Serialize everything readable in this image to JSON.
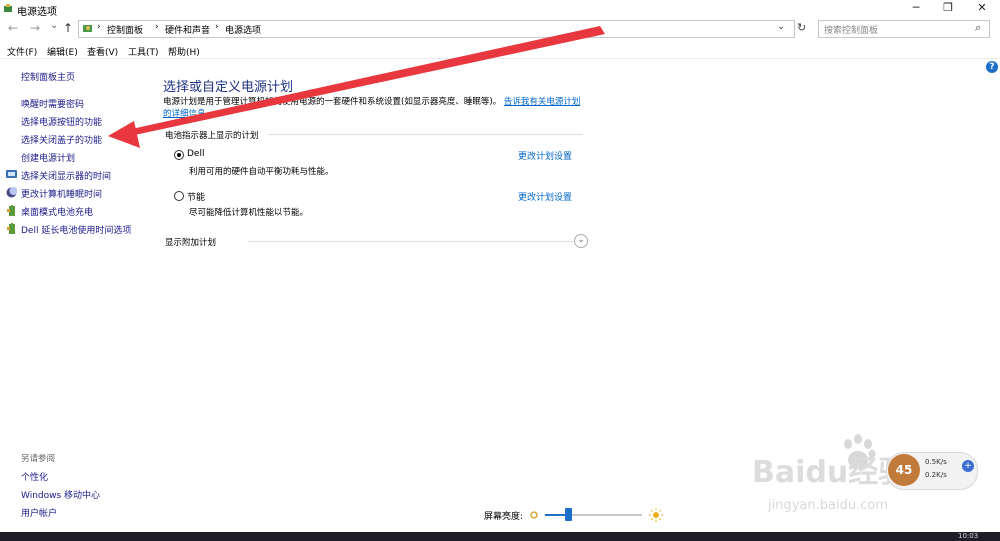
{
  "window": {
    "title": "电源选项",
    "minimize_glyph": "─",
    "maximize_glyph": "❐",
    "close_glyph": "✕"
  },
  "navigation": {
    "back_glyph": "←",
    "forward_glyph": "→",
    "dropdown_glyph": "⌄",
    "up_glyph": "↑",
    "breadcrumb": [
      "控制面板",
      "硬件和声音",
      "电源选项"
    ],
    "breadcrumb_sep": "›",
    "refresh_glyph": "↻",
    "search_placeholder": "搜索控制面板",
    "search_glyph": "⌕"
  },
  "menu": [
    "文件(F)",
    "编辑(E)",
    "查看(V)",
    "工具(T)",
    "帮助(H)"
  ],
  "sidebar": {
    "home": "控制面板主页",
    "items": [
      {
        "label": "唤醒时需要密码",
        "icon": "none"
      },
      {
        "label": "选择电源按钮的功能",
        "icon": "none"
      },
      {
        "label": "选择关闭盖子的功能",
        "icon": "none"
      },
      {
        "label": "创建电源计划",
        "icon": "none"
      },
      {
        "label": "选择关闭显示器的时间",
        "icon": "monitor-icon"
      },
      {
        "label": "更改计算机睡眠时间",
        "icon": "moon-icon"
      },
      {
        "label": "桌面模式电池充电",
        "icon": "battery-icon"
      },
      {
        "label": "Dell 延长电池使用时间选项",
        "icon": "battery-icon"
      }
    ],
    "see_also_title": "另请参阅",
    "see_also": [
      "个性化",
      "Windows 移动中心",
      "用户帐户"
    ]
  },
  "main": {
    "heading": "选择或自定义电源计划",
    "description": "电源计划是用于管理计算机如何使用电源的一套硬件和系统设置(如显示器亮度、睡眠等)。",
    "description_link": "告诉我有关电源计划的详细信息",
    "battery_group_label": "电池指示器上显示的计划",
    "plans": [
      {
        "name": "Dell",
        "desc": "利用可用的硬件自动平衡功耗与性能。",
        "selected": true,
        "link": "更改计划设置"
      },
      {
        "name": "节能",
        "desc": "尽可能降低计算机性能以节能。",
        "selected": false,
        "link": "更改计划设置"
      }
    ],
    "additional_plans_label": "显示附加计划",
    "brightness_label": "屏幕亮度:",
    "brightness_level": 0.24
  },
  "help_glyph": "?",
  "overlay": {
    "watermark_logo": "Baidu经验",
    "watermark_url": "jingyan.baidu.com",
    "net_speed_up": "0.5K/s",
    "net_speed_down": "0.2K/s",
    "net_percent": "45",
    "clock": "10:03"
  },
  "colors": {
    "heading": "#1e3287",
    "link": "#0066cc",
    "arrow": "#e8373e",
    "taskbar": "#1e1e24"
  }
}
